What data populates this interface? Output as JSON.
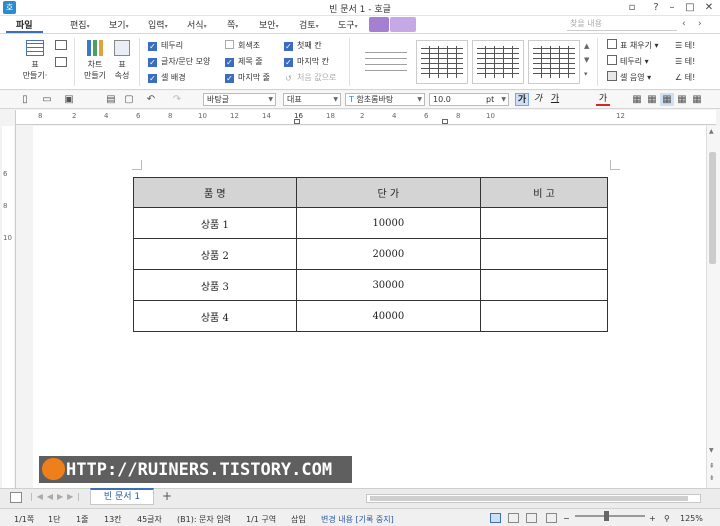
{
  "window": {
    "title": "빈 문서 1 - 호글",
    "app_icon": "호",
    "controls": {
      "restore": "▫",
      "help": "?",
      "minimize": "–",
      "maximize": "□",
      "close": "✕"
    }
  },
  "menu": {
    "file": "파일",
    "items": [
      "편집",
      "보기",
      "입력",
      "서식",
      "쪽",
      "보안",
      "검토",
      "도구"
    ],
    "search_placeholder": "찾을 내용"
  },
  "ribbon": {
    "table_btn": "표\n만들기",
    "table_btn_line1": "표",
    "table_btn_line2": "만들기·",
    "chart_btn_line1": "차트",
    "chart_btn_line2": "만들기",
    "prop_btn_line1": "표",
    "prop_btn_line2": "속성",
    "checks": [
      {
        "label": "테두리",
        "checked": true
      },
      {
        "label": "글자/문단 모양",
        "checked": true
      },
      {
        "label": "셀 배경",
        "checked": true
      },
      {
        "label": "회색조",
        "checked": false
      },
      {
        "label": "제목 줄",
        "checked": true
      },
      {
        "label": "마지막 줄",
        "checked": true
      },
      {
        "label": "첫째 칸",
        "checked": true
      },
      {
        "label": "마지막 칸",
        "checked": true
      },
      {
        "label": "처음 값으로",
        "checked": false,
        "disabled": true
      }
    ],
    "right_cmds": [
      "표 채우기",
      "테두리",
      "셀 음영"
    ],
    "right_cmds2": [
      "테!",
      "테!",
      "테!"
    ]
  },
  "toolbar": {
    "style": "바탕글",
    "font_type": "대표",
    "font": "함초롬바탕",
    "size": "10.0",
    "unit": "pt",
    "bold": "가",
    "italic": "가",
    "underline": "가",
    "font_color": "가"
  },
  "ruler": [
    "8",
    "2",
    "4",
    "6",
    "8",
    "10",
    "12",
    "14",
    "16",
    "18",
    "2",
    "4",
    "6",
    "8",
    "10",
    "12"
  ],
  "vruler": [
    "6",
    "8",
    "10"
  ],
  "table": {
    "headers": [
      "품 명",
      "단 가",
      "비 고"
    ],
    "rows": [
      [
        "상품 1",
        "10000",
        ""
      ],
      [
        "상품 2",
        "20000",
        ""
      ],
      [
        "상품 3",
        "30000",
        ""
      ],
      [
        "상품 4",
        "40000",
        ""
      ]
    ]
  },
  "banner": {
    "text": "HTTP://RUINERS.TISTORY.COM"
  },
  "tabs": {
    "doc": "빈 문서 1",
    "add": "+"
  },
  "status": {
    "page": "1/1쪽",
    "section": "1단",
    "line": "1줄",
    "col": "13칸",
    "chars": "45글자",
    "cell": "(B1): 문자 입력",
    "zone": "1/1 구역",
    "mode": "삽입",
    "track": "변경 내용 [기록 중지]",
    "zoom": "125%"
  },
  "colors": {
    "accent": "#3b6fb6",
    "table_header": "#d4d4d4",
    "banner_bg": "#5f5f5f",
    "banner_logo": "#ef7f1a"
  }
}
